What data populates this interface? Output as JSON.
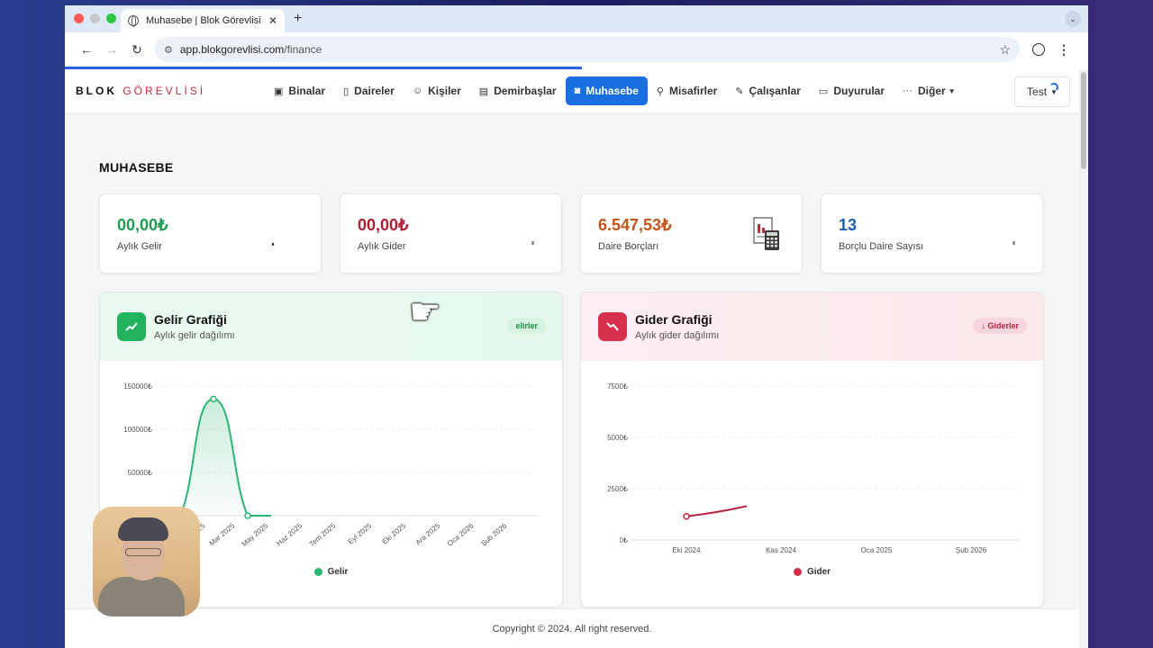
{
  "browser": {
    "tab_title": "Muhasebe | Blok Görevlisi",
    "url_host": "app.blokgorevlisi.com",
    "url_path": "/finance"
  },
  "brand": {
    "part1": "BLOK",
    "part2": "GÖREVLİSİ"
  },
  "nav": {
    "items": [
      {
        "label": "Binalar",
        "icon": "building-icon"
      },
      {
        "label": "Daireler",
        "icon": "door-icon"
      },
      {
        "label": "Kişiler",
        "icon": "person-icon"
      },
      {
        "label": "Demirbaşlar",
        "icon": "table-icon"
      },
      {
        "label": "Muhasebe",
        "icon": "money-icon",
        "active": true
      },
      {
        "label": "Misafirler",
        "icon": "walking-icon"
      },
      {
        "label": "Çalışanlar",
        "icon": "worker-icon"
      },
      {
        "label": "Duyurular",
        "icon": "message-icon"
      },
      {
        "label": "Diğer",
        "icon": "more-icon",
        "dropdown": true
      }
    ],
    "user_label": "Test"
  },
  "page": {
    "title": "MUHASEBE"
  },
  "stats": [
    {
      "value": "00,00₺",
      "label": "Aylık Gelir",
      "color": "#1f9d55"
    },
    {
      "value": "00,00₺",
      "label": "Aylık Gider",
      "color": "#b01e32"
    },
    {
      "value": "6.547,53₺",
      "label": "Daire Borçları",
      "color": "#c4541a"
    },
    {
      "value": "13",
      "label": "Borçlu Daire Sayısı",
      "color": "#1f5fb0"
    }
  ],
  "income_card": {
    "title": "Gelir Grafiği",
    "subtitle": "Aylık gelir dağılımı",
    "pill": "elirler",
    "legend": "Gelir"
  },
  "expense_card": {
    "title": "Gider Grafiği",
    "subtitle": "Aylık gider dağılımı",
    "pill": "↓ Giderler",
    "legend": "Gider"
  },
  "chart_data": [
    {
      "type": "area",
      "y_ticks": [
        "150000₺",
        "100000₺",
        "50000₺"
      ],
      "x_ticks": [
        "2025",
        "Mar 2025",
        "May 2025",
        "Haz 2025",
        "Tem 2025",
        "Eyl 2025",
        "Eki 2025",
        "Ara 2025",
        "Oca 2026",
        "Şub 2026"
      ],
      "ylim": [
        0,
        150000
      ],
      "series": [
        {
          "name": "Gelir",
          "color": "#2bb673",
          "points": [
            0,
            135000,
            0,
            0
          ]
        }
      ],
      "grid": true,
      "legend": "bottom"
    },
    {
      "type": "line",
      "y_ticks": [
        "7500₺",
        "5000₺",
        "2500₺",
        "0₺"
      ],
      "x_ticks": [
        "Eki 2024",
        "Kas 2024",
        "Oca 2025",
        "Şub 2026"
      ],
      "ylim": [
        0,
        7500
      ],
      "series": [
        {
          "name": "Gider",
          "color": "#b5263f",
          "points": [
            1150,
            1650
          ]
        }
      ],
      "grid": true,
      "legend": "bottom"
    }
  ],
  "footer": {
    "text": "Copyright © 2024. All right reserved."
  }
}
